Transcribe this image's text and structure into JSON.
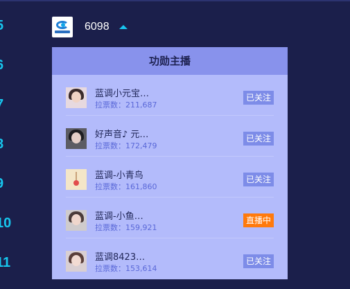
{
  "rank_numbers": [
    "5",
    "6",
    "7",
    "8",
    "9",
    "10",
    "11"
  ],
  "header": {
    "logo_icon": "brand-logo-icon",
    "user_id": "6098",
    "caret_icon": "caret-up-icon"
  },
  "panel": {
    "title": "功勋主播",
    "items": [
      {
        "name": "蓝调小元宝…",
        "votes": "拉票数：211,687",
        "status": "已关注",
        "live": false
      },
      {
        "name": "好声音♪ 元…",
        "votes": "拉票数：172,479",
        "status": "已关注",
        "live": false
      },
      {
        "name": "蓝调-小青鸟",
        "votes": "拉票数：161,860",
        "status": "已关注",
        "live": false
      },
      {
        "name": "蓝调-小鱼…",
        "votes": "拉票数：159,921",
        "status": "直播中",
        "live": true
      },
      {
        "name": "蓝调8423…",
        "votes": "拉票数：153,614",
        "status": "已关注",
        "live": false
      }
    ]
  },
  "colors": {
    "background": "#1b1f4b",
    "accent": "#17c6ee",
    "panel": "#b3bbfb",
    "panel_header": "#8892ec",
    "follow_badge": "#7d8ce8",
    "live_badge": "#ff7a0c"
  }
}
